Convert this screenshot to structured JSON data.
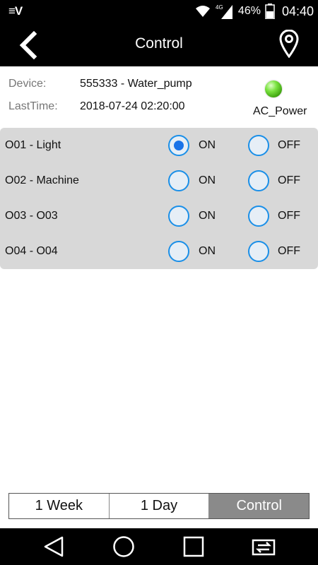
{
  "status_bar": {
    "carrier_logo": "≡V",
    "network": "4G",
    "battery_percent": "46%",
    "time": "04:40",
    "icons": [
      "wifi-icon",
      "signal-icon",
      "battery-icon"
    ]
  },
  "header": {
    "title": "Control",
    "back_icon": "chevron-left-icon",
    "location_icon": "location-pin-icon"
  },
  "device_info": {
    "device_label": "Device:",
    "device_value": "555333 - Water_pump",
    "lasttime_label": "LastTime:",
    "lasttime_value": "2018-07-24 02:20:00",
    "power_status": "AC_Power",
    "power_color": "#4ec21c"
  },
  "outputs": [
    {
      "name": "O01 - Light",
      "on_label": "ON",
      "off_label": "OFF",
      "state": "on"
    },
    {
      "name": "O02 - Machine",
      "on_label": "ON",
      "off_label": "OFF",
      "state": "none"
    },
    {
      "name": "O03 - O03",
      "on_label": "ON",
      "off_label": "OFF",
      "state": "none"
    },
    {
      "name": "O04 - O04",
      "on_label": "ON",
      "off_label": "OFF",
      "state": "none"
    }
  ],
  "tabs": [
    {
      "label": "1 Week",
      "active": false
    },
    {
      "label": "1 Day",
      "active": false
    },
    {
      "label": "Control",
      "active": true
    }
  ],
  "navbar": {
    "icons": [
      "back-triangle-icon",
      "home-circle-icon",
      "recents-square-icon",
      "switch-apps-icon"
    ]
  },
  "colors": {
    "accent": "#1a73e8",
    "panel_bg": "#d8d8d8",
    "active_tab": "#8a8a8a"
  }
}
